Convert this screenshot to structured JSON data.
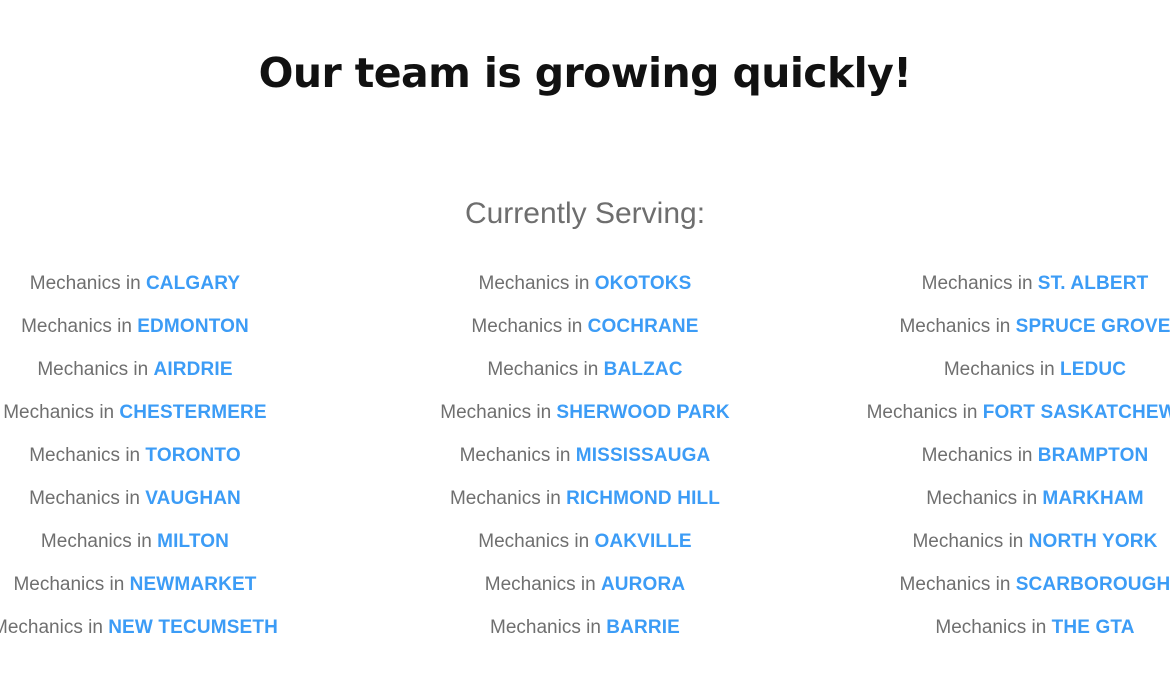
{
  "colors": {
    "background": "#ffffff",
    "title": "#111111",
    "subtitle": "#6e6e6e",
    "body_text": "#6f6f6f",
    "city_accent": "#3c9cf6"
  },
  "header": {
    "title": "Our team is growing quickly!",
    "subtitle": "Currently Serving:"
  },
  "service_areas": {
    "prefix": "Mechanics in",
    "columns": [
      {
        "items": [
          {
            "prefix": "Mechanics in",
            "city": "CALGARY"
          },
          {
            "prefix": "Mechanics in",
            "city": "EDMONTON"
          },
          {
            "prefix": "Mechanics in",
            "city": "AIRDRIE"
          },
          {
            "prefix": "Mechanics in",
            "city": "CHESTERMERE"
          },
          {
            "prefix": "Mechanics in",
            "city": "TORONTO"
          },
          {
            "prefix": "Mechanics in",
            "city": "VAUGHAN"
          },
          {
            "prefix": "Mechanics in",
            "city": "MILTON"
          },
          {
            "prefix": "Mechanics in",
            "city": "NEWMARKET"
          },
          {
            "prefix": "Mechanics in",
            "city": "NEW TECUMSETH"
          }
        ]
      },
      {
        "items": [
          {
            "prefix": "Mechanics in",
            "city": "OKOTOKS"
          },
          {
            "prefix": "Mechanics in",
            "city": "COCHRANE"
          },
          {
            "prefix": "Mechanics in",
            "city": "BALZAC"
          },
          {
            "prefix": "Mechanics in",
            "city": "SHERWOOD PARK"
          },
          {
            "prefix": "Mechanics in",
            "city": "MISSISSAUGA"
          },
          {
            "prefix": "Mechanics in",
            "city": "RICHMOND HILL"
          },
          {
            "prefix": "Mechanics in",
            "city": "OAKVILLE"
          },
          {
            "prefix": "Mechanics in",
            "city": "AURORA"
          },
          {
            "prefix": "Mechanics in",
            "city": "BARRIE"
          }
        ]
      },
      {
        "items": [
          {
            "prefix": "Mechanics in",
            "city": "ST. ALBERT"
          },
          {
            "prefix": "Mechanics in",
            "city": "SPRUCE GROVE"
          },
          {
            "prefix": "Mechanics in",
            "city": "LEDUC"
          },
          {
            "prefix": "Mechanics in",
            "city": "FORT SASKATCHEWAN"
          },
          {
            "prefix": "Mechanics in",
            "city": "BRAMPTON"
          },
          {
            "prefix": "Mechanics in",
            "city": "MARKHAM"
          },
          {
            "prefix": "Mechanics in",
            "city": "NORTH YORK"
          },
          {
            "prefix": "Mechanics in",
            "city": "SCARBOROUGH"
          },
          {
            "prefix": "Mechanics in",
            "city": "THE GTA"
          }
        ]
      }
    ]
  }
}
